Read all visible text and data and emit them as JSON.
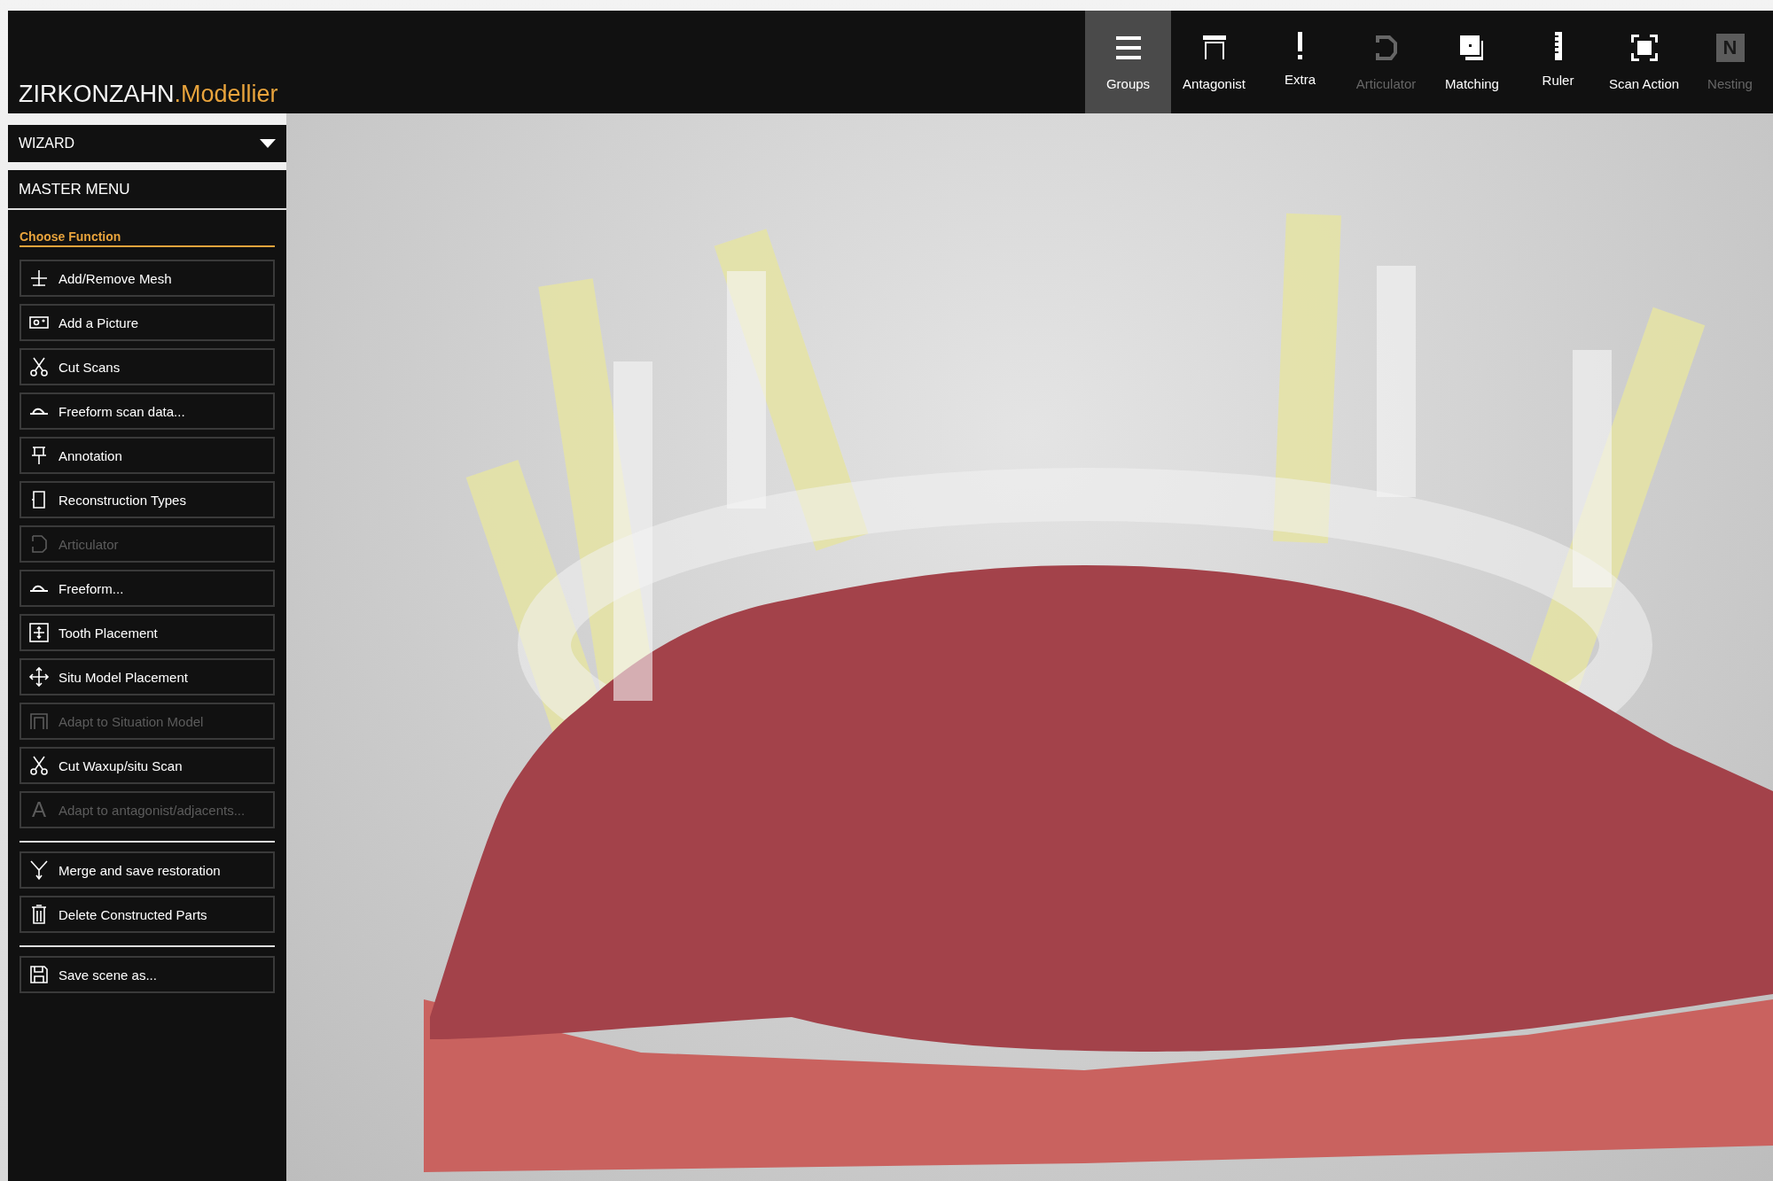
{
  "brand": {
    "name": "ZIRKONZAHN",
    "product": ".Modellier"
  },
  "toolbar": [
    {
      "label": "Groups",
      "selected": true,
      "disabled": false
    },
    {
      "label": "Antagonist",
      "selected": false,
      "disabled": false
    },
    {
      "label": "Extra",
      "selected": false,
      "disabled": false
    },
    {
      "label": "Articulator",
      "selected": false,
      "disabled": true
    },
    {
      "label": "Matching",
      "selected": false,
      "disabled": false
    },
    {
      "label": "Ruler",
      "selected": false,
      "disabled": false
    },
    {
      "label": "Scan Action",
      "selected": false,
      "disabled": false
    },
    {
      "label": "Nesting",
      "selected": false,
      "disabled": true,
      "icon_text": "N"
    }
  ],
  "sidebar": {
    "wizard": {
      "label": "WIZARD",
      "expanded": false
    },
    "master_menu": "MASTER MENU",
    "section_title": "Choose Function",
    "groups": [
      [
        {
          "label": "Add/Remove Mesh",
          "disabled": false
        },
        {
          "label": "Add a Picture",
          "disabled": false
        },
        {
          "label": "Cut Scans",
          "disabled": false
        },
        {
          "label": "Freeform scan data...",
          "disabled": false
        },
        {
          "label": "Annotation",
          "disabled": false
        },
        {
          "label": "Reconstruction Types",
          "disabled": false
        },
        {
          "label": "Articulator",
          "disabled": true
        },
        {
          "label": "Freeform...",
          "disabled": false
        },
        {
          "label": "Tooth Placement",
          "disabled": false
        },
        {
          "label": "Situ Model Placement",
          "disabled": false
        },
        {
          "label": "Adapt to Situation Model",
          "disabled": true
        },
        {
          "label": "Cut Waxup/situ Scan",
          "disabled": false
        },
        {
          "label": "Adapt to antagonist/adjacents...",
          "disabled": true,
          "icon_text": "A"
        }
      ],
      [
        {
          "label": "Merge and save restoration",
          "disabled": false
        },
        {
          "label": "Delete Constructed Parts",
          "disabled": false
        }
      ],
      [
        {
          "label": "Save scene as...",
          "disabled": false
        }
      ]
    ]
  }
}
